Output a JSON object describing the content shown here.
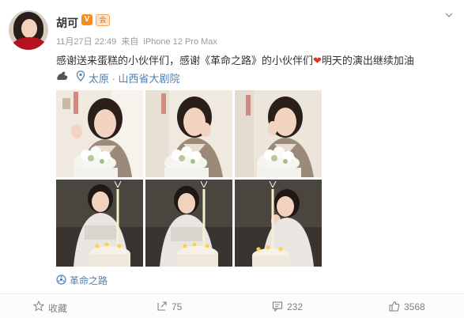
{
  "user": {
    "name": "胡可",
    "badge_v": "V",
    "badge_club": "会",
    "avatar_icon": "avatar-icon"
  },
  "meta": {
    "date": "11月27日 22:49",
    "source_prefix": "来自",
    "device": "iPhone 12 Pro Max"
  },
  "post": {
    "text_before_heart": "感谢送来蛋糕的小伙伴们，感谢《革命之路》的小伙伴们",
    "heart": "❤",
    "text_after_heart": "明天的演出继续加油",
    "location": "太原 · 山西省大剧院",
    "topic": "革命之路"
  },
  "photos": [
    {
      "name": "photo-1",
      "kind": "white-cake"
    },
    {
      "name": "photo-2",
      "kind": "white-cake"
    },
    {
      "name": "photo-3",
      "kind": "white-cake"
    },
    {
      "name": "photo-4",
      "kind": "candle-cake"
    },
    {
      "name": "photo-5",
      "kind": "candle-cake"
    },
    {
      "name": "photo-6",
      "kind": "candle-cake"
    }
  ],
  "actions": {
    "favorite_label": "收藏",
    "repost_count": "75",
    "comment_count": "232",
    "like_count": "3568"
  },
  "colors": {
    "link": "#527fac",
    "text": "#333333",
    "muted": "#999999",
    "heart": "#e8302a",
    "badge_orange": "#f78c1e"
  }
}
